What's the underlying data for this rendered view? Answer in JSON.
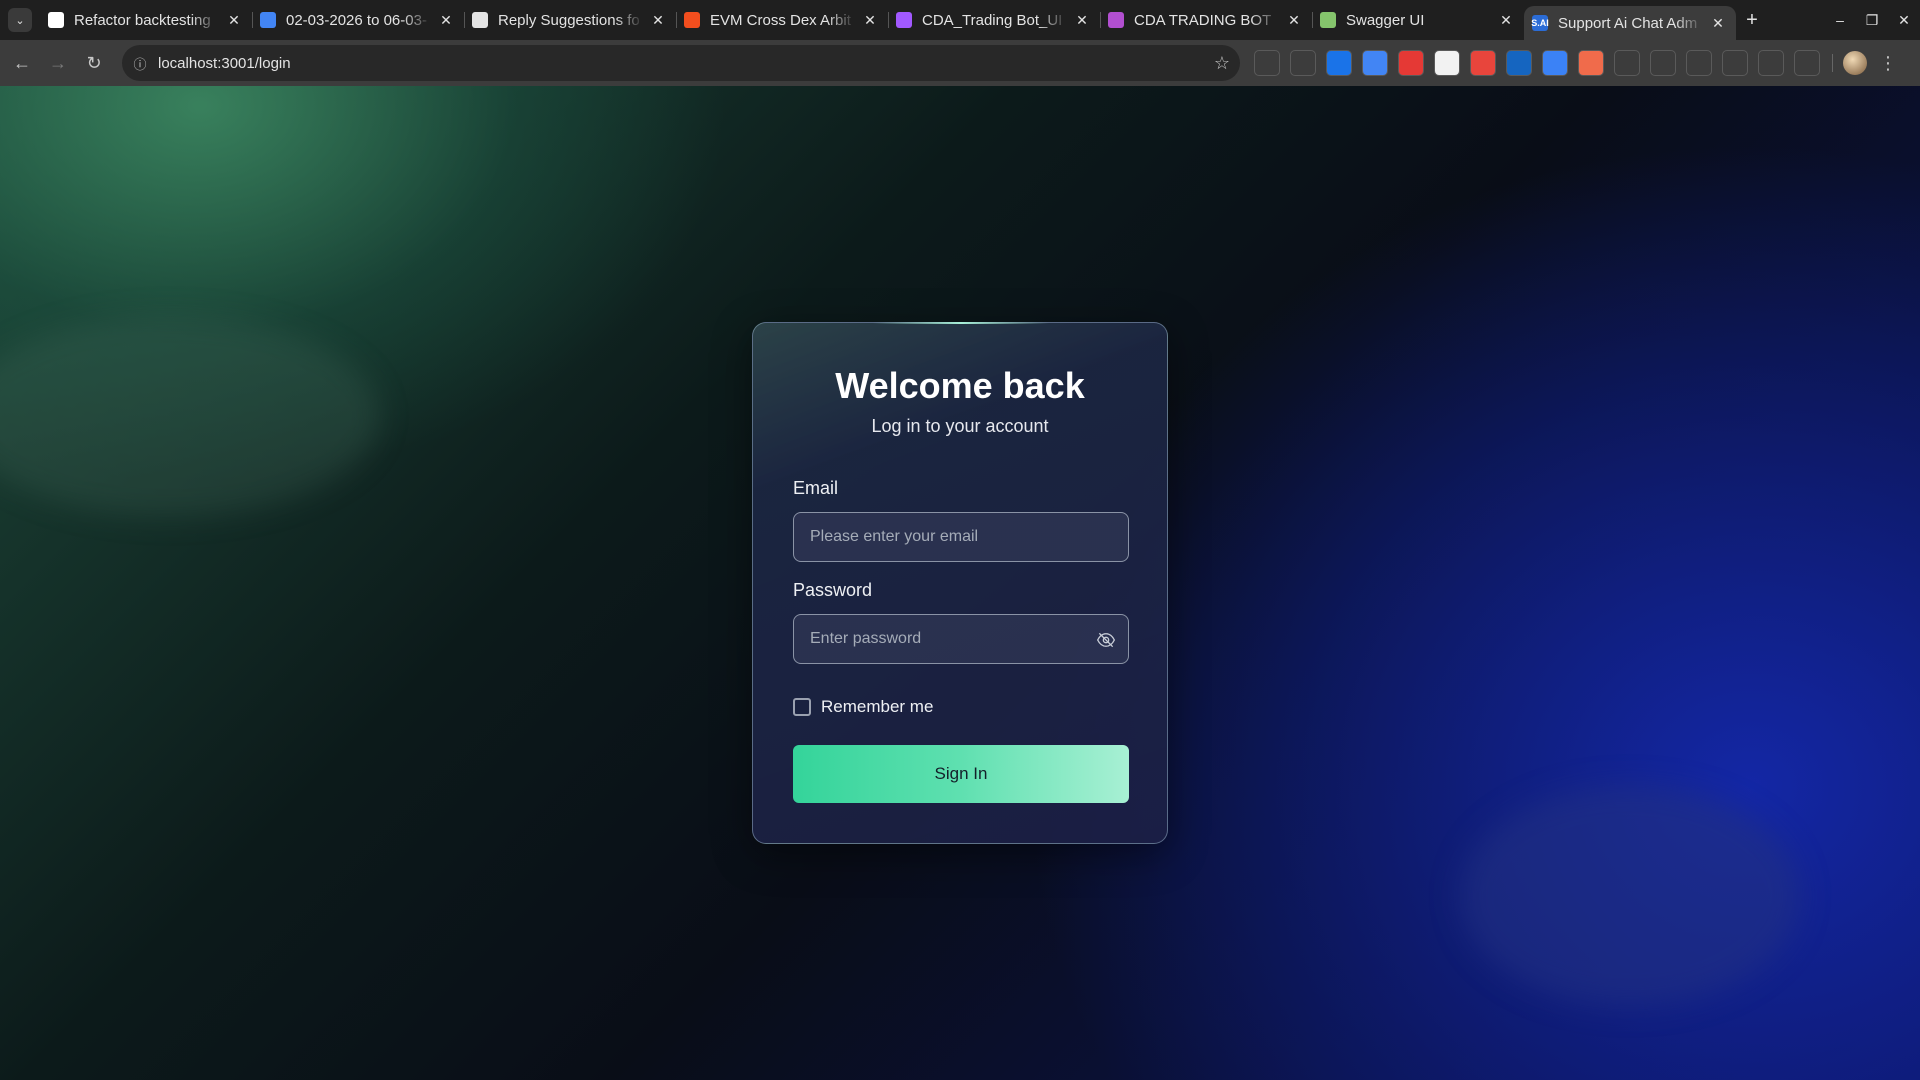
{
  "browser": {
    "tabs": [
      {
        "title": "Refactor backtesting",
        "icon": "github-icon",
        "color": "#ffffff",
        "glyph": "",
        "active": false
      },
      {
        "title": "02-03-2026 to 06-03-",
        "icon": "google-docs-icon",
        "color": "#4285f4",
        "glyph": "",
        "active": false
      },
      {
        "title": "Reply Suggestions fo",
        "icon": "openai-icon",
        "color": "#e3e3e3",
        "glyph": "",
        "active": false
      },
      {
        "title": "EVM Cross Dex Arbit",
        "icon": "figma-icon",
        "color": "#f24e1e",
        "glyph": "",
        "active": false
      },
      {
        "title": "CDA_Trading Bot_UI",
        "icon": "figma-icon",
        "color": "#a259ff",
        "glyph": "",
        "active": false
      },
      {
        "title": "CDA TRADING BOT",
        "icon": "clickup-icon",
        "color": "#b24fd0",
        "glyph": "",
        "active": false
      },
      {
        "title": "Swagger UI",
        "icon": "swagger-icon",
        "color": "#85c46c",
        "glyph": "",
        "active": false
      },
      {
        "title": "Support Ai Chat Adm",
        "icon": "sai-icon",
        "color": "#2b6cd6",
        "glyph": "S.AI",
        "active": true
      }
    ],
    "url": "localhost:3001/login"
  },
  "extensions": [
    {
      "icon": "phone-icon",
      "color": "#3c3c3c",
      "glyph": ""
    },
    {
      "icon": "eye-extension-icon",
      "color": "#3c3c3c",
      "glyph": ""
    },
    {
      "icon": "mail-icon",
      "color": "#1a73e8",
      "glyph": ""
    },
    {
      "icon": "translate-icon",
      "color": "#4285f4",
      "glyph": ""
    },
    {
      "icon": "pdf-icon",
      "color": "#e53935",
      "glyph": ""
    },
    {
      "icon": "notion-icon",
      "color": "#f2f2f2",
      "glyph": ""
    },
    {
      "icon": "hand-icon",
      "color": "#e8453c",
      "glyph": ""
    },
    {
      "icon": "fd-icon",
      "color": "#1565c0",
      "glyph": ""
    },
    {
      "icon": "gear-extension-icon",
      "color": "#3b82f6",
      "glyph": ""
    },
    {
      "icon": "grid-extension-icon",
      "color": "#f06b4b",
      "glyph": ""
    },
    {
      "icon": "bug-icon",
      "color": "#3c3c3c",
      "glyph": ""
    },
    {
      "icon": "capture-icon",
      "color": "#3c3c3c",
      "glyph": ""
    },
    {
      "icon": "pen-icon",
      "color": "#3c3c3c",
      "glyph": ""
    },
    {
      "icon": "fox-icon",
      "color": "#3c3c3c",
      "glyph": ""
    },
    {
      "icon": "tag-icon",
      "color": "#3c3c3c",
      "glyph": ""
    },
    {
      "icon": "puzzle-icon",
      "color": "#3c3c3c",
      "glyph": ""
    }
  ],
  "login": {
    "title": "Welcome back",
    "subtitle": "Log in to your account",
    "email_label": "Email",
    "email_placeholder": "Please enter your email",
    "password_label": "Password",
    "password_placeholder": "Enter password",
    "remember_label": "Remember me",
    "signin_label": "Sign In"
  },
  "colors": {
    "accent": "#34d49a",
    "background_green": "#3e8c64",
    "background_blue": "#1428aa"
  }
}
